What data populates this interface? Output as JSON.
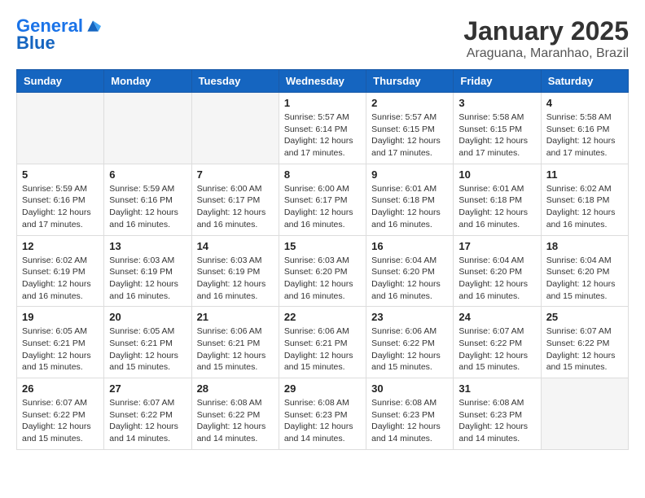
{
  "header": {
    "logo_line1": "General",
    "logo_line2": "Blue",
    "month_title": "January 2025",
    "location": "Araguana, Maranhao, Brazil"
  },
  "weekdays": [
    "Sunday",
    "Monday",
    "Tuesday",
    "Wednesday",
    "Thursday",
    "Friday",
    "Saturday"
  ],
  "weeks": [
    [
      {
        "day": "",
        "info": ""
      },
      {
        "day": "",
        "info": ""
      },
      {
        "day": "",
        "info": ""
      },
      {
        "day": "1",
        "info": "Sunrise: 5:57 AM\nSunset: 6:14 PM\nDaylight: 12 hours\nand 17 minutes."
      },
      {
        "day": "2",
        "info": "Sunrise: 5:57 AM\nSunset: 6:15 PM\nDaylight: 12 hours\nand 17 minutes."
      },
      {
        "day": "3",
        "info": "Sunrise: 5:58 AM\nSunset: 6:15 PM\nDaylight: 12 hours\nand 17 minutes."
      },
      {
        "day": "4",
        "info": "Sunrise: 5:58 AM\nSunset: 6:16 PM\nDaylight: 12 hours\nand 17 minutes."
      }
    ],
    [
      {
        "day": "5",
        "info": "Sunrise: 5:59 AM\nSunset: 6:16 PM\nDaylight: 12 hours\nand 17 minutes."
      },
      {
        "day": "6",
        "info": "Sunrise: 5:59 AM\nSunset: 6:16 PM\nDaylight: 12 hours\nand 16 minutes."
      },
      {
        "day": "7",
        "info": "Sunrise: 6:00 AM\nSunset: 6:17 PM\nDaylight: 12 hours\nand 16 minutes."
      },
      {
        "day": "8",
        "info": "Sunrise: 6:00 AM\nSunset: 6:17 PM\nDaylight: 12 hours\nand 16 minutes."
      },
      {
        "day": "9",
        "info": "Sunrise: 6:01 AM\nSunset: 6:18 PM\nDaylight: 12 hours\nand 16 minutes."
      },
      {
        "day": "10",
        "info": "Sunrise: 6:01 AM\nSunset: 6:18 PM\nDaylight: 12 hours\nand 16 minutes."
      },
      {
        "day": "11",
        "info": "Sunrise: 6:02 AM\nSunset: 6:18 PM\nDaylight: 12 hours\nand 16 minutes."
      }
    ],
    [
      {
        "day": "12",
        "info": "Sunrise: 6:02 AM\nSunset: 6:19 PM\nDaylight: 12 hours\nand 16 minutes."
      },
      {
        "day": "13",
        "info": "Sunrise: 6:03 AM\nSunset: 6:19 PM\nDaylight: 12 hours\nand 16 minutes."
      },
      {
        "day": "14",
        "info": "Sunrise: 6:03 AM\nSunset: 6:19 PM\nDaylight: 12 hours\nand 16 minutes."
      },
      {
        "day": "15",
        "info": "Sunrise: 6:03 AM\nSunset: 6:20 PM\nDaylight: 12 hours\nand 16 minutes."
      },
      {
        "day": "16",
        "info": "Sunrise: 6:04 AM\nSunset: 6:20 PM\nDaylight: 12 hours\nand 16 minutes."
      },
      {
        "day": "17",
        "info": "Sunrise: 6:04 AM\nSunset: 6:20 PM\nDaylight: 12 hours\nand 16 minutes."
      },
      {
        "day": "18",
        "info": "Sunrise: 6:04 AM\nSunset: 6:20 PM\nDaylight: 12 hours\nand 15 minutes."
      }
    ],
    [
      {
        "day": "19",
        "info": "Sunrise: 6:05 AM\nSunset: 6:21 PM\nDaylight: 12 hours\nand 15 minutes."
      },
      {
        "day": "20",
        "info": "Sunrise: 6:05 AM\nSunset: 6:21 PM\nDaylight: 12 hours\nand 15 minutes."
      },
      {
        "day": "21",
        "info": "Sunrise: 6:06 AM\nSunset: 6:21 PM\nDaylight: 12 hours\nand 15 minutes."
      },
      {
        "day": "22",
        "info": "Sunrise: 6:06 AM\nSunset: 6:21 PM\nDaylight: 12 hours\nand 15 minutes."
      },
      {
        "day": "23",
        "info": "Sunrise: 6:06 AM\nSunset: 6:22 PM\nDaylight: 12 hours\nand 15 minutes."
      },
      {
        "day": "24",
        "info": "Sunrise: 6:07 AM\nSunset: 6:22 PM\nDaylight: 12 hours\nand 15 minutes."
      },
      {
        "day": "25",
        "info": "Sunrise: 6:07 AM\nSunset: 6:22 PM\nDaylight: 12 hours\nand 15 minutes."
      }
    ],
    [
      {
        "day": "26",
        "info": "Sunrise: 6:07 AM\nSunset: 6:22 PM\nDaylight: 12 hours\nand 15 minutes."
      },
      {
        "day": "27",
        "info": "Sunrise: 6:07 AM\nSunset: 6:22 PM\nDaylight: 12 hours\nand 14 minutes."
      },
      {
        "day": "28",
        "info": "Sunrise: 6:08 AM\nSunset: 6:22 PM\nDaylight: 12 hours\nand 14 minutes."
      },
      {
        "day": "29",
        "info": "Sunrise: 6:08 AM\nSunset: 6:23 PM\nDaylight: 12 hours\nand 14 minutes."
      },
      {
        "day": "30",
        "info": "Sunrise: 6:08 AM\nSunset: 6:23 PM\nDaylight: 12 hours\nand 14 minutes."
      },
      {
        "day": "31",
        "info": "Sunrise: 6:08 AM\nSunset: 6:23 PM\nDaylight: 12 hours\nand 14 minutes."
      },
      {
        "day": "",
        "info": ""
      }
    ]
  ]
}
